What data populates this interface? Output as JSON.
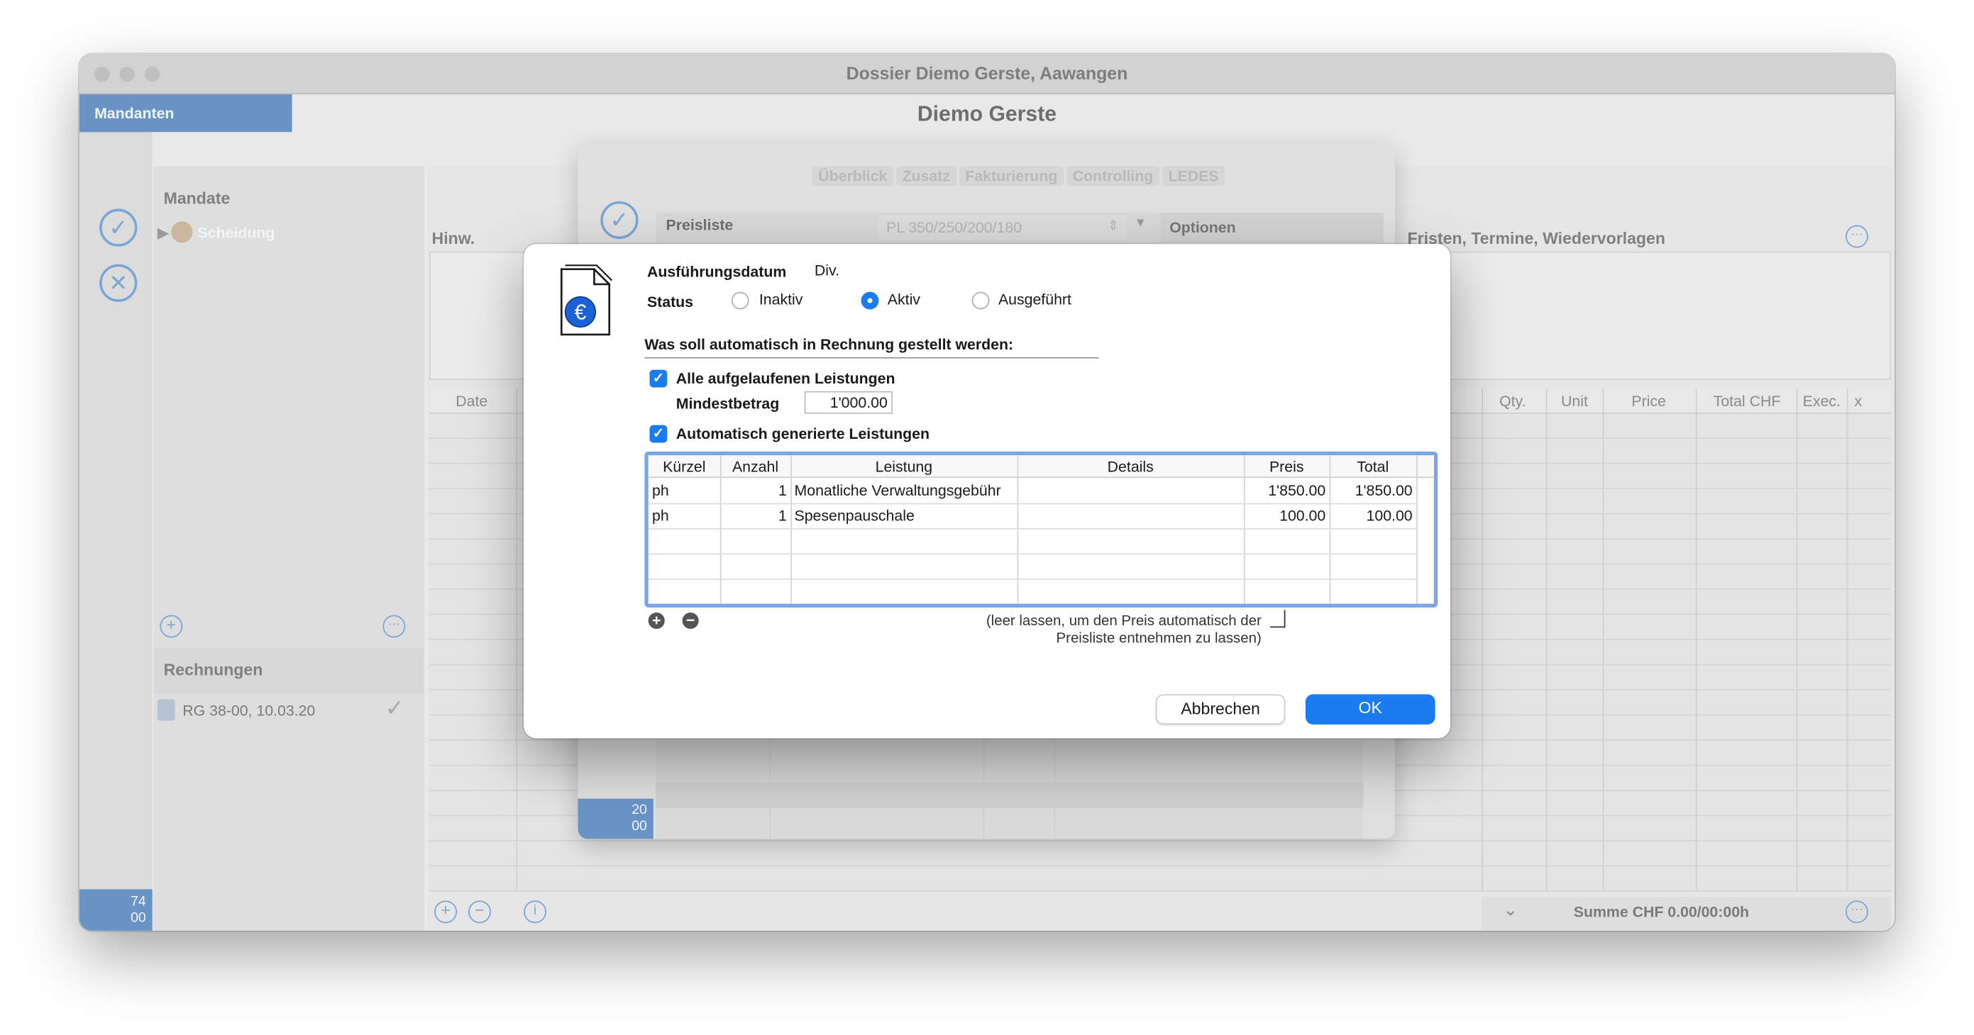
{
  "window": {
    "title": "Dossier Diemo Gerste, Aawangen"
  },
  "sidebar": {
    "mandanten_label": "Mandanten",
    "badge_lines": [
      "74",
      "00"
    ]
  },
  "client": {
    "name": "Diemo Gerste"
  },
  "mandate": {
    "header": "Mandate",
    "items": [
      {
        "label": "Scheidung"
      }
    ]
  },
  "rechnungen": {
    "header": "Rechnungen",
    "items": [
      {
        "label": "RG 38-00, 10.03.20"
      }
    ]
  },
  "hinweise": {
    "label": "Hinw."
  },
  "fristen": {
    "label": "Fristen, Termine, Wiedervorlagen"
  },
  "services_table": {
    "col_date": "Date",
    "headers_right": [
      "Qty.",
      "Unit",
      "Price",
      "Total CHF",
      "Exec.",
      "x"
    ]
  },
  "footer": {
    "summe": "Summe CHF 0.00/00:00h"
  },
  "mandate_sheet": {
    "tabs": [
      "Überblick",
      "Zusatz",
      "Fakturierung",
      "Controlling",
      "LEDES"
    ],
    "preisliste_label": "Preisliste",
    "preisliste_value": "PL 350/250/200/180",
    "optionen_label": "Optionen",
    "badge_lines": [
      "20",
      "00"
    ]
  },
  "dialog": {
    "ausfuehrungsdatum_label": "Ausführungsdatum",
    "ausfuehrungsdatum_value": "Div.",
    "status_label": "Status",
    "status_options": [
      "Inaktiv",
      "Aktiv",
      "Ausgeführt"
    ],
    "status_selected": "Aktiv",
    "question": "Was soll automatisch in Rechnung gestellt werden:",
    "check_all_label": "Alle aufgelaufenen Leistungen",
    "check_all_checked": true,
    "mindestbetrag_label": "Mindestbetrag",
    "mindestbetrag_value": "1'000.00",
    "check_auto_label": "Automatisch generierte Leistungen",
    "check_auto_checked": true,
    "table_headers": [
      "Kürzel",
      "Anzahl",
      "Leistung",
      "Details",
      "Preis",
      "Total"
    ],
    "rows": [
      {
        "kuerzel": "ph",
        "anzahl": "1",
        "leistung": "Monatliche Verwaltungsgebühr",
        "details": "",
        "preis": "1'850.00",
        "total": "1'850.00"
      },
      {
        "kuerzel": "ph",
        "anzahl": "1",
        "leistung": "Spesenpauschale",
        "details": "",
        "preis": "100.00",
        "total": "100.00"
      }
    ],
    "hint_line1": "(leer lassen, um den Preis automatisch der",
    "hint_line2": "Preisliste entnehmen zu lassen)",
    "cancel_label": "Abbrechen",
    "ok_label": "OK",
    "accent": "#1a7cf0"
  }
}
